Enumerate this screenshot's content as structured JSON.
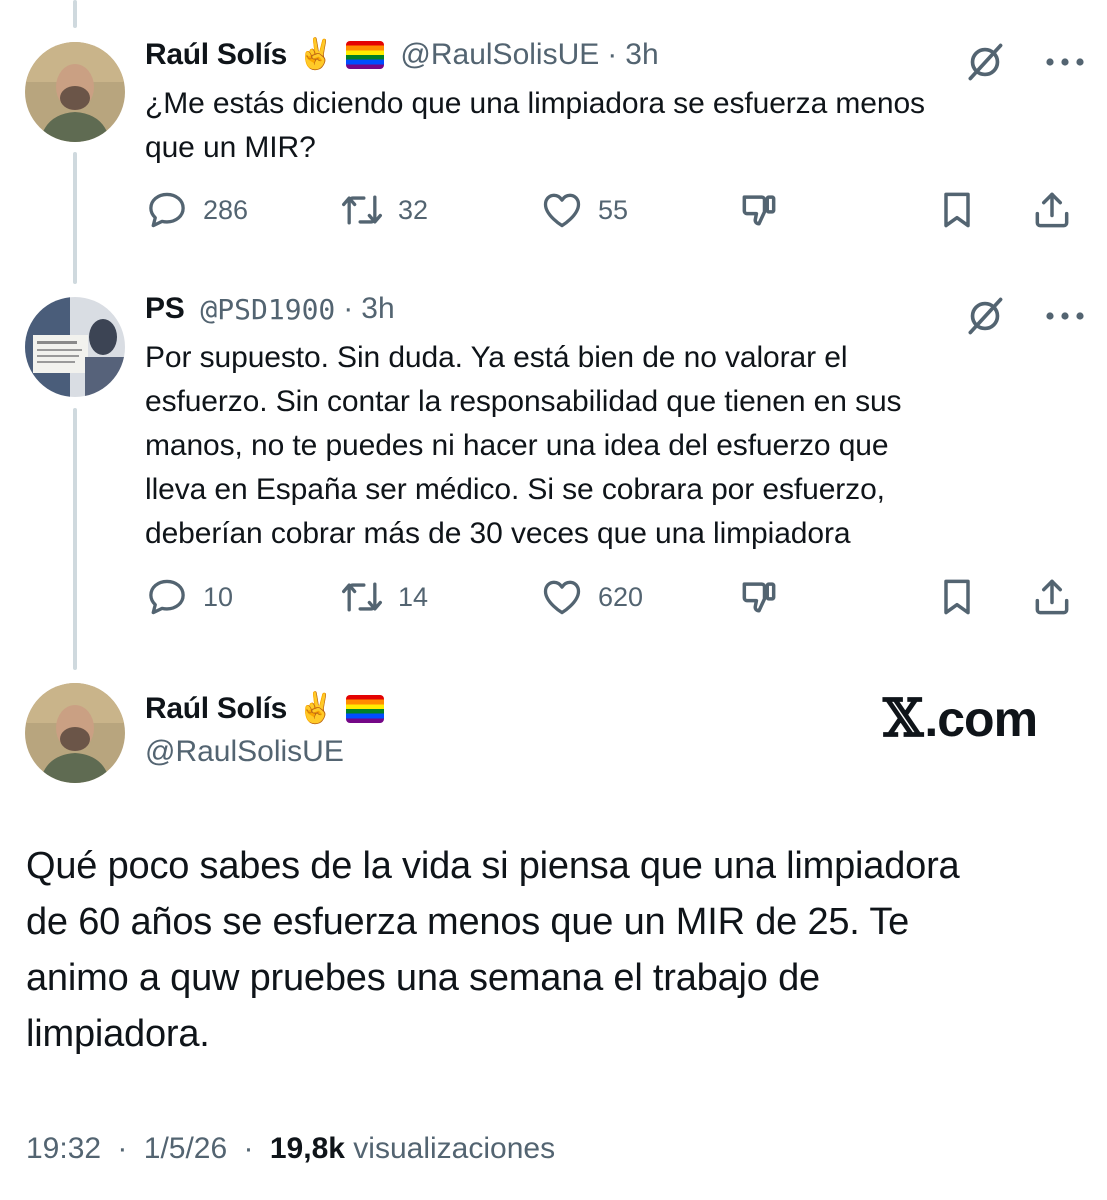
{
  "tweet1": {
    "name": "Raúl Solís",
    "emoji": "✌️",
    "handle": "@RaulSolisUE",
    "separator": "·",
    "time": "3h",
    "lines": [
      "¿Me estás diciendo que una limpiadora se esfuerza menos",
      "que un MIR?"
    ],
    "replies": "286",
    "reposts": "32",
    "likes": "55"
  },
  "tweet2": {
    "name": "PS",
    "handle": "@PSD1900",
    "separator": "·",
    "time": "3h",
    "lines": [
      "Por supuesto. Sin duda. Ya está bien de no valorar el",
      "esfuerzo. Sin contar la responsabilidad que tienen en sus",
      "manos, no te puedes ni hacer una idea del esfuerzo que",
      "lleva en España ser médico. Si se cobrara  por esfuerzo,",
      "deberían cobrar más de 30 veces que una limpiadora"
    ],
    "replies": "10",
    "reposts": "14",
    "likes": "620"
  },
  "main": {
    "name": "Raúl Solís",
    "emoji": "✌️",
    "handle": "@RaulSolisUE",
    "brand_x": "𝕏",
    "brand_rest": ".com",
    "lines": [
      "Qué poco sabes de la vida si piensa que una limpiadora",
      "de 60 años se esfuerza menos que un MIR de 25. Te",
      "animo a quw pruebes una semana el trabajo de",
      "limpiadora."
    ],
    "time": "19:32",
    "date": "1/5/26",
    "separator": "·",
    "views": "19,8k",
    "views_label": "visualizaciones"
  },
  "icons": {
    "reply": "speech-bubble-icon",
    "repost": "repost-arrows-icon",
    "like": "heart-icon",
    "dislike": "thumb-down-icon",
    "bookmark": "bookmark-icon",
    "share": "share-upload-icon",
    "grok": "grok-slash-icon",
    "more": "more-dots-icon"
  },
  "colors": {
    "text": "#0f1419",
    "secondary": "#536471",
    "thread_line": "#cfd9de"
  }
}
